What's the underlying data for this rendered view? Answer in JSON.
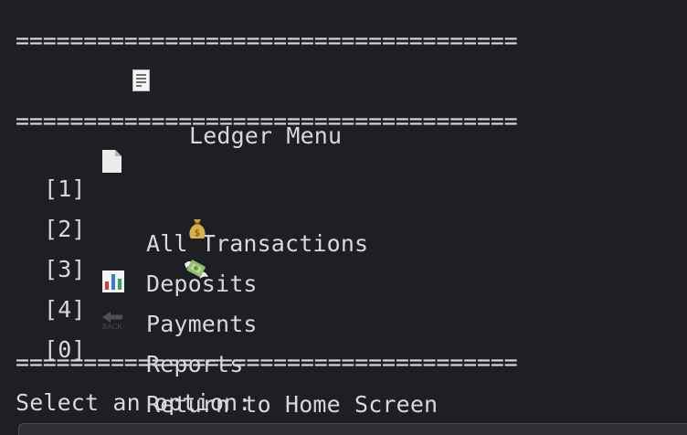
{
  "console": {
    "separator_top": "=====================================",
    "title_text": "Ledger Menu",
    "separator_mid": "=====================================",
    "menu": [
      {
        "key": "[1]",
        "label": "All Transactions",
        "icon": "document-icon"
      },
      {
        "key": "[2]",
        "label": "Deposits",
        "icon": "money-bag-icon"
      },
      {
        "key": "[3]",
        "label": "Payments",
        "icon": "money-with-wings-icon"
      },
      {
        "key": "[4]",
        "label": "Reports",
        "icon": "bar-chart-icon"
      },
      {
        "key": "[0]",
        "label": "Return to Home Screen",
        "icon": "back-arrow-icon"
      }
    ],
    "separator_bottom": "=====================================",
    "prompt": "Select an option:",
    "back_icon_text": "BACK",
    "colors": {
      "background": "#1e1f22",
      "text": "#d7d8dc"
    }
  }
}
